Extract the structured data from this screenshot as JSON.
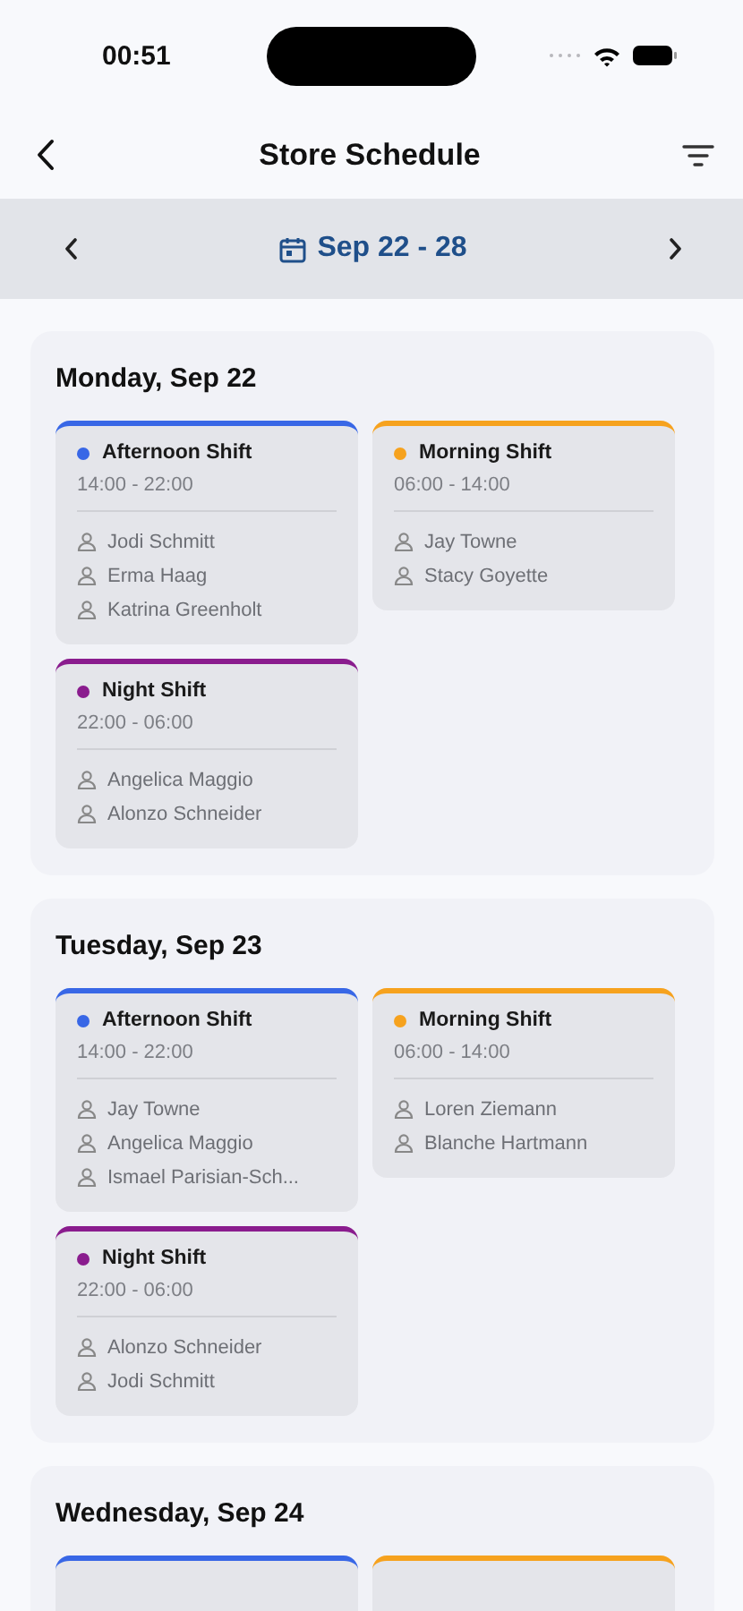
{
  "status_bar": {
    "time": "00:51"
  },
  "header": {
    "title": "Store Schedule"
  },
  "week": {
    "range": "Sep 22 - 28"
  },
  "days": [
    {
      "title": "Monday, Sep 22",
      "shifts": [
        {
          "name": "Afternoon Shift",
          "time": "14:00 - 22:00",
          "color": "#3867e6",
          "staff": [
            "Jodi Schmitt",
            "Erma Haag",
            "Katrina Greenholt"
          ]
        },
        {
          "name": "Morning Shift",
          "time": "06:00 - 14:00",
          "color": "#f6a21e",
          "staff": [
            "Jay Towne",
            "Stacy Goyette"
          ]
        },
        {
          "name": "Night Shift",
          "time": "22:00 - 06:00",
          "color": "#8a1c8e",
          "staff": [
            "Angelica Maggio",
            "Alonzo Schneider"
          ]
        }
      ]
    },
    {
      "title": "Tuesday, Sep 23",
      "shifts": [
        {
          "name": "Afternoon Shift",
          "time": "14:00 - 22:00",
          "color": "#3867e6",
          "staff": [
            "Jay Towne",
            "Angelica Maggio",
            "Ismael Parisian-Sch..."
          ]
        },
        {
          "name": "Morning Shift",
          "time": "06:00 - 14:00",
          "color": "#f6a21e",
          "staff": [
            "Loren Ziemann",
            "Blanche Hartmann"
          ]
        },
        {
          "name": "Night Shift",
          "time": "22:00 - 06:00",
          "color": "#8a1c8e",
          "staff": [
            "Alonzo Schneider",
            "Jodi Schmitt"
          ]
        }
      ]
    },
    {
      "title": "Wednesday, Sep 24",
      "shifts": [
        {
          "color": "#3867e6"
        },
        {
          "color": "#f6a21e"
        }
      ]
    }
  ]
}
